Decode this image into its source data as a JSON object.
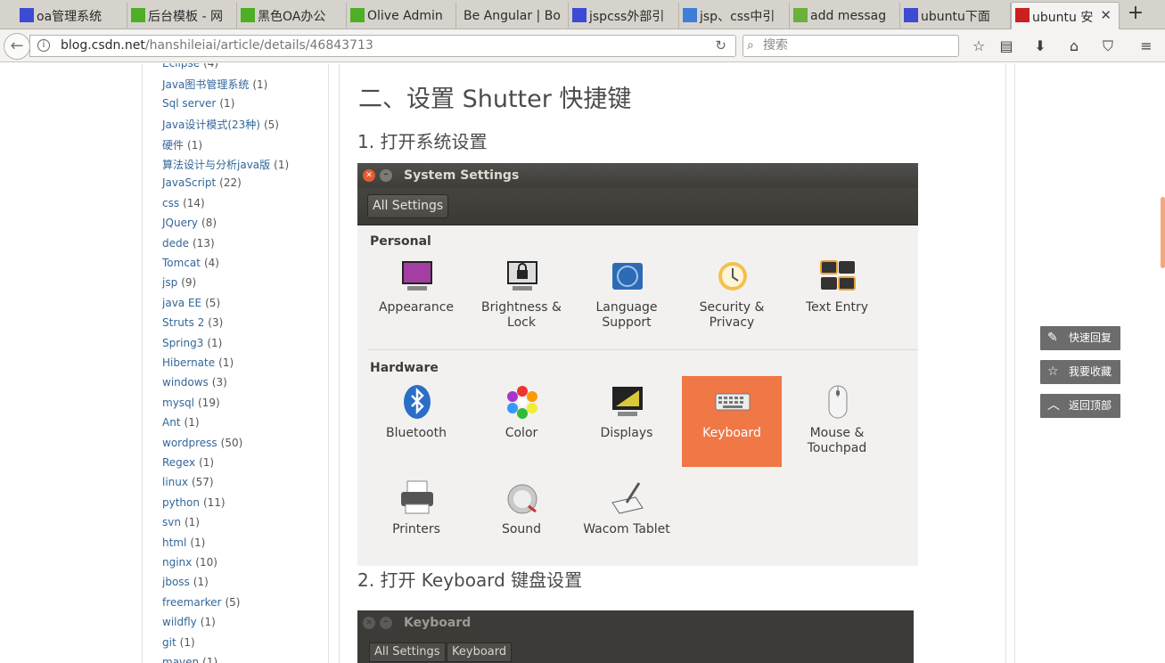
{
  "tabs": [
    {
      "label": "oa管理系统",
      "favicon": "oa-icon",
      "color": "#3d4ad3",
      "active": false
    },
    {
      "label": "后台模板 - 网",
      "favicon": "m-icon",
      "color": "#4caf24",
      "active": false
    },
    {
      "label": "黑色OA办公",
      "favicon": "m-icon",
      "color": "#4caf24",
      "active": false
    },
    {
      "label": "Olive Admin",
      "favicon": "m-icon",
      "color": "#4caf24",
      "active": false
    },
    {
      "label": "Be Angular | Bo",
      "favicon": "",
      "color": "",
      "active": false
    },
    {
      "label": "jspcss外部引",
      "favicon": "baidu-icon",
      "color": "#3d4ad3",
      "active": false
    },
    {
      "label": "jsp、css中引",
      "favicon": "sogou-icon",
      "color": "#3f7ed8",
      "active": false
    },
    {
      "label": "add messag",
      "favicon": "leaf-icon",
      "color": "#6ab03a",
      "active": false
    },
    {
      "label": "ubuntu下面",
      "favicon": "baidu-icon",
      "color": "#3d4ad3",
      "active": false
    },
    {
      "label": "ubuntu 安",
      "favicon": "csdn-icon",
      "color": "#cc1f1f",
      "active": true
    }
  ],
  "nav": {
    "url_host": "blog.csdn.net",
    "url_path": "/hanshileiai/article/details/46843713",
    "search_placeholder": "搜索"
  },
  "sidebar": {
    "categories": [
      {
        "name": "Eclipse",
        "count": "(4)"
      },
      {
        "name": "Java图书管理系统",
        "count": "(1)"
      },
      {
        "name": "Sql server",
        "count": "(1)"
      },
      {
        "name": "Java设计模式(23种)",
        "count": "(5)"
      },
      {
        "name": "硬件",
        "count": "(1)"
      },
      {
        "name": "算法设计与分析java版",
        "count": "(1)"
      },
      {
        "name": "JavaScript",
        "count": "(22)"
      },
      {
        "name": "css",
        "count": "(14)"
      },
      {
        "name": "JQuery",
        "count": "(8)"
      },
      {
        "name": "dede",
        "count": "(13)"
      },
      {
        "name": "Tomcat",
        "count": "(4)"
      },
      {
        "name": "jsp",
        "count": "(9)"
      },
      {
        "name": "java EE",
        "count": "(5)"
      },
      {
        "name": "Struts 2",
        "count": "(3)"
      },
      {
        "name": "Spring3",
        "count": "(1)"
      },
      {
        "name": "Hibernate",
        "count": "(1)"
      },
      {
        "name": "windows",
        "count": "(3)"
      },
      {
        "name": "mysql",
        "count": "(19)"
      },
      {
        "name": "Ant",
        "count": "(1)"
      },
      {
        "name": "wordpress",
        "count": "(50)"
      },
      {
        "name": "Regex",
        "count": "(1)"
      },
      {
        "name": "linux",
        "count": "(57)"
      },
      {
        "name": "python",
        "count": "(11)"
      },
      {
        "name": "svn",
        "count": "(1)"
      },
      {
        "name": "html",
        "count": "(1)"
      },
      {
        "name": "nginx",
        "count": "(10)"
      },
      {
        "name": "jboss",
        "count": "(1)"
      },
      {
        "name": "freemarker",
        "count": "(5)"
      },
      {
        "name": "wildfly",
        "count": "(1)"
      },
      {
        "name": "git",
        "count": "(1)"
      },
      {
        "name": "maven",
        "count": "(1)"
      }
    ]
  },
  "article": {
    "heading": "二、设置 Shutter 快捷键",
    "step1": "1. 打开系统设置",
    "step2": "2. 打开 Keyboard 键盘设置"
  },
  "settings": {
    "window_title": "System Settings",
    "all_settings": "All Settings",
    "personal_label": "Personal",
    "hardware_label": "Hardware",
    "personal": [
      {
        "label": "Appearance",
        "icon": "appearance-icon"
      },
      {
        "label": "Brightness & Lock",
        "icon": "brightness-lock-icon"
      },
      {
        "label": "Language Support",
        "icon": "language-support-icon"
      },
      {
        "label": "Security & Privacy",
        "icon": "security-privacy-icon"
      },
      {
        "label": "Text Entry",
        "icon": "text-entry-icon"
      }
    ],
    "hardware": [
      {
        "label": "Bluetooth",
        "icon": "bluetooth-icon"
      },
      {
        "label": "Color",
        "icon": "color-icon"
      },
      {
        "label": "Displays",
        "icon": "displays-icon"
      },
      {
        "label": "Keyboard",
        "icon": "keyboard-icon",
        "selected": true
      },
      {
        "label": "Mouse & Touchpad",
        "icon": "mouse-icon"
      }
    ],
    "hardware2": [
      {
        "label": "Printers",
        "icon": "printer-icon"
      },
      {
        "label": "Sound",
        "icon": "sound-icon"
      },
      {
        "label": "Wacom Tablet",
        "icon": "wacom-tablet-icon"
      }
    ]
  },
  "keyboard_window": {
    "title": "Keyboard",
    "crumb1": "All Settings",
    "crumb2": "Keyboard"
  },
  "float_buttons": {
    "reply": "快速回复",
    "favorite": "我要收藏",
    "top": "返回顶部"
  }
}
